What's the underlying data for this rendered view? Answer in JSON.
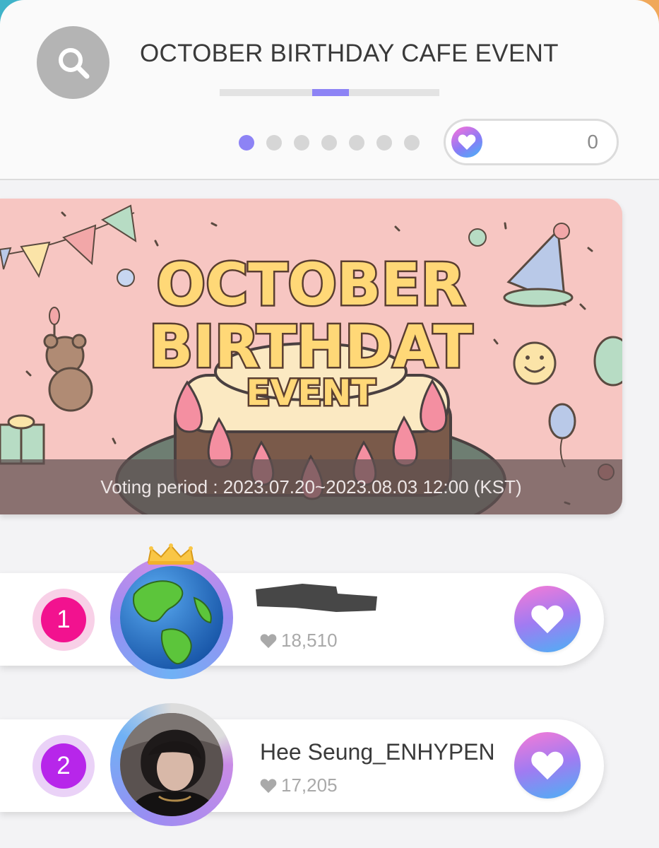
{
  "header": {
    "title": "OCTOBER BIRTHDAY CAFE EVENT",
    "progress_fraction": 0.167,
    "page_dots_count": 7,
    "active_dot_index": 0,
    "heart_count": "0"
  },
  "banner": {
    "line1": "OCTOBER",
    "line2": "BIRTHDAT",
    "line3": "EVENT",
    "voting_period": "Voting period : 2023.07.20~2023.08.03 12:00 (KST)"
  },
  "ranking": [
    {
      "rank": "1",
      "name": "",
      "votes": "18,510",
      "rank_color": "#f2128f",
      "avatar": "earth-avatar",
      "crown": true
    },
    {
      "rank": "2",
      "name": "Hee Seung_ENHYPEN",
      "votes": "17,205",
      "rank_color": "#b726ea",
      "avatar": "portrait-avatar",
      "crown": false
    }
  ],
  "colors": {
    "accent": "#8d83f5",
    "banner_bg": "#f7c6c2"
  }
}
